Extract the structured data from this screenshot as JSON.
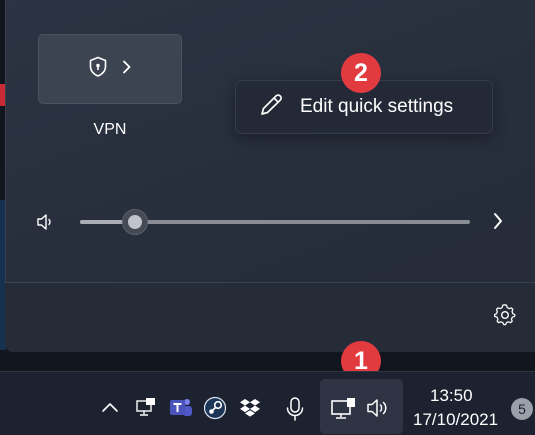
{
  "quick_settings": {
    "vpn": {
      "label": "VPN",
      "icon": "shield-lock-icon",
      "arrow_icon": "chevron-right-icon"
    },
    "edit_tooltip": {
      "icon": "pencil-icon",
      "text": "Edit quick settings"
    },
    "volume": {
      "icon": "speaker-icon",
      "level_percent": 14,
      "arrow_icon": "chevron-right-icon"
    },
    "settings_icon": "gear-icon"
  },
  "annotations": {
    "badge_1": "1",
    "badge_2": "2",
    "color": "#e23b3f"
  },
  "taskbar": {
    "tray_icons": [
      "chevron-up-icon",
      "network-monitor-icon",
      "teams-icon",
      "steam-icon",
      "dropbox-icon",
      "microphone-icon",
      "monitor-network-icon",
      "volume-icon"
    ],
    "clock": {
      "time": "13:50",
      "date": "17/10/2021"
    },
    "notification_count": "5"
  }
}
